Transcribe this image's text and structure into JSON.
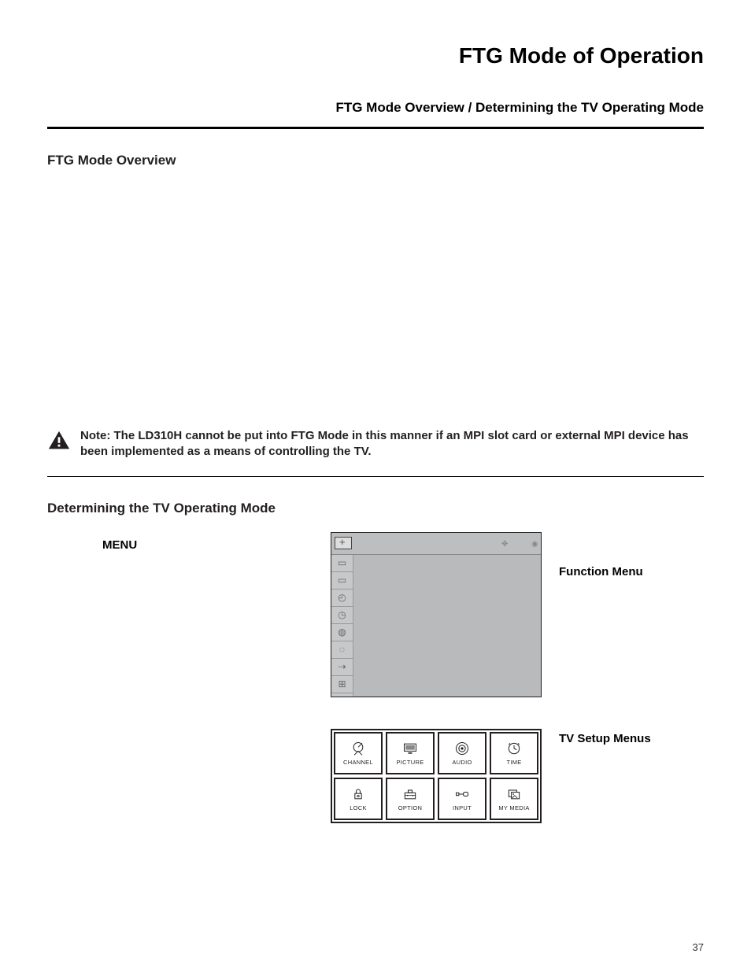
{
  "page_title": "FTG Mode of Operation",
  "sub_title": "FTG Mode Overview / Determining the TV Operating Mode",
  "section1_heading": "FTG Mode Overview",
  "note_text": "Note: The LD310H cannot be put into FTG Mode in this manner if an MPI slot card or external MPI device has been implemented as a means of controlling the TV.",
  "section2_heading": "Determining the TV Operating Mode",
  "menu_label": "MENU",
  "function_menu_label": "Function Menu",
  "tv_setup_label": "TV Setup Menus",
  "setup_cells": [
    {
      "label": "CHANNEL"
    },
    {
      "label": "PICTURE"
    },
    {
      "label": "AUDIO"
    },
    {
      "label": "TIME"
    },
    {
      "label": "LOCK"
    },
    {
      "label": "OPTION"
    },
    {
      "label": "INPUT"
    },
    {
      "label": "MY MEDIA"
    }
  ],
  "page_number": "37"
}
